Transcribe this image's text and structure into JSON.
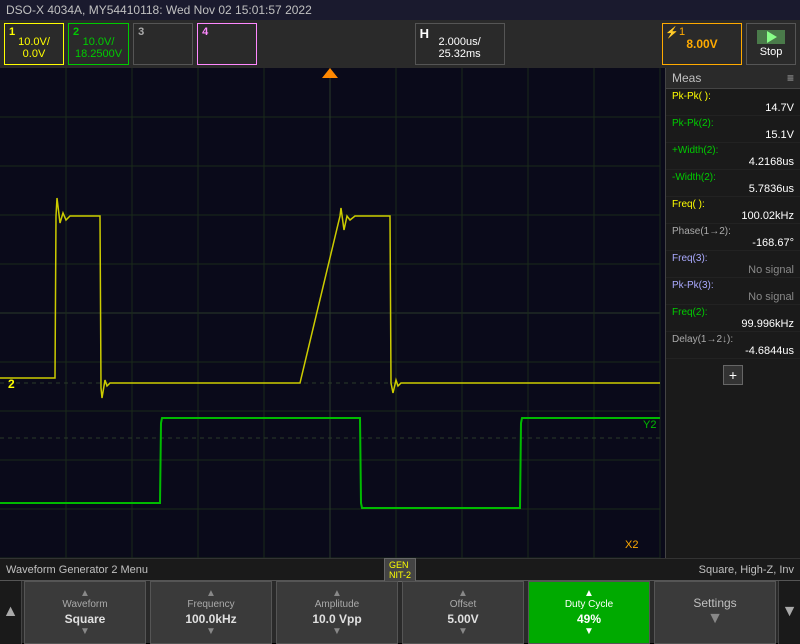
{
  "title_bar": {
    "text": "DSO-X 4034A, MY54410118: Wed Nov 02 15:01:57 2022"
  },
  "controls": {
    "ch1": {
      "label": "1",
      "val1": "10.0V/",
      "val2": "0.0V"
    },
    "ch2": {
      "label": "2",
      "val1": "10.0V/",
      "val2": "18.2500V"
    },
    "ch3": {
      "label": "3",
      "val1": "",
      "val2": ""
    },
    "ch4": {
      "label": "4",
      "val1": "",
      "val2": ""
    },
    "time": {
      "h_label": "H",
      "val1": "2.000us/",
      "val2": "25.32ms"
    },
    "trigger": {
      "lightning": "⚡",
      "label": "1",
      "voltage": "8.00V",
      "stop": "Stop"
    }
  },
  "measurements": {
    "header": "Meas",
    "items": [
      {
        "label": "Pk-Pk(  ):",
        "value": "14.7V"
      },
      {
        "label": "Pk-Pk(2):",
        "value": "15.1V"
      },
      {
        "label": "+Width(2):",
        "value": "4.2168us"
      },
      {
        "label": "-Width(2):",
        "value": "5.7836us"
      },
      {
        "label": "Freq(  ):",
        "value": "100.02kHz"
      },
      {
        "label": "Phase(1→2):",
        "value": "-168.67°"
      },
      {
        "label": "Freq(3):",
        "value": "No signal"
      },
      {
        "label": "Pk-Pk(3):",
        "value": "No signal"
      },
      {
        "label": "Freq(2):",
        "value": "99.996kHz"
      },
      {
        "label": "Delay(1→2↓):",
        "value": "-4.6844us"
      }
    ],
    "plus_btn": "+"
  },
  "status_bar": {
    "left": "Waveform Generator 2 Menu",
    "gen_badge": "GEN\nNIT-2",
    "right": "Square, High-Z, Inv"
  },
  "toolbar": {
    "left_arrow": "◀",
    "right_arrow": "▼",
    "buttons": [
      {
        "label": "Waveform",
        "value": "Square",
        "active": false
      },
      {
        "label": "Frequency",
        "value": "100.0kHz",
        "active": false
      },
      {
        "label": "Amplitude",
        "value": "10.0 Vpp",
        "active": false
      },
      {
        "label": "Offset",
        "value": "5.00V",
        "active": false
      },
      {
        "label": "Duty Cycle",
        "value": "49%",
        "active": true
      },
      {
        "label": "Settings",
        "value": "",
        "active": false,
        "is_settings": true
      }
    ]
  }
}
